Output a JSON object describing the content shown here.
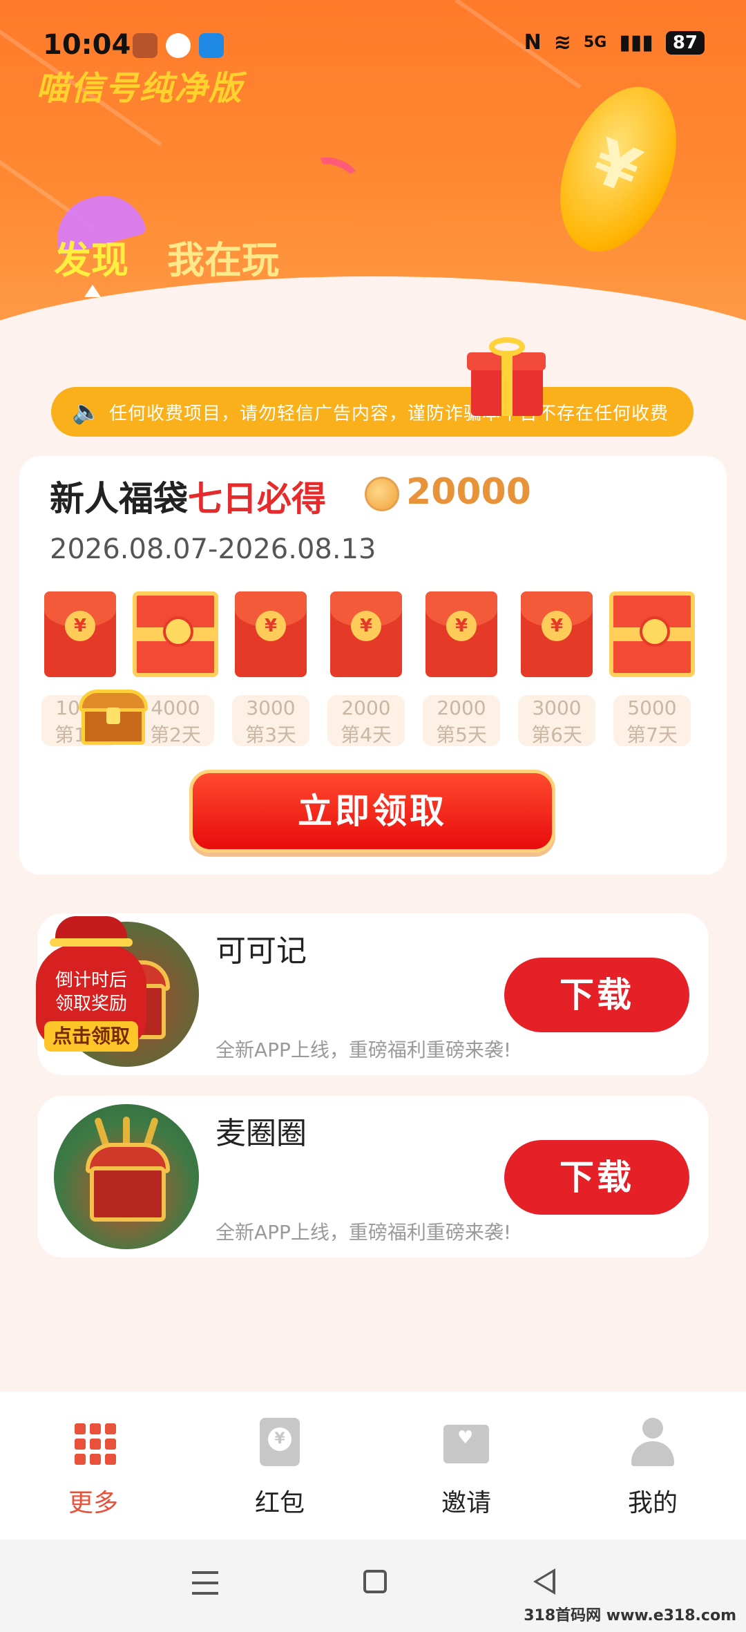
{
  "status_bar": {
    "time": "10:04",
    "network": "5G",
    "battery": "87",
    "nfc_glyph": "N",
    "wifi_glyph": "≋",
    "signal_glyph": "▮▮▮"
  },
  "header": {
    "watermark": "喵信号纯净版",
    "tabs": [
      {
        "label": "发现",
        "active": true
      },
      {
        "label": "我在玩",
        "active": false
      }
    ],
    "coin_glyph": "¥"
  },
  "notice": {
    "icon": "speaker-icon",
    "text": "任何收费项目，请勿轻信广告内容，谨防诈骗本平台不存在任何收费"
  },
  "bonus": {
    "title_prefix": "新人福袋",
    "title_highlight": "七日必得",
    "amount": "20000",
    "dates": "2026.08.07-2026.08.13",
    "days": [
      {
        "amount": "1000",
        "label": "第1天",
        "style": "small"
      },
      {
        "amount": "4000",
        "label": "第2天",
        "style": "big"
      },
      {
        "amount": "3000",
        "label": "第3天",
        "style": "small"
      },
      {
        "amount": "2000",
        "label": "第4天",
        "style": "small"
      },
      {
        "amount": "2000",
        "label": "第5天",
        "style": "small"
      },
      {
        "amount": "3000",
        "label": "第6天",
        "style": "small"
      },
      {
        "amount": "5000",
        "label": "第7天",
        "style": "big"
      }
    ],
    "envelope_glyph": "¥",
    "claim_label": "立即领取"
  },
  "countdown_badge": {
    "line1": "倒计时后",
    "line2": "领取奖励",
    "cta": "点击领取"
  },
  "apps": [
    {
      "name": "可可记",
      "desc": "全新APP上线，重磅福利重磅来袭!",
      "button": "下载"
    },
    {
      "name": "麦圈圈",
      "desc": "全新APP上线，重磅福利重磅来袭!",
      "button": "下载"
    }
  ],
  "bottom_nav": [
    {
      "label": "更多",
      "icon": "grid-icon",
      "active": true
    },
    {
      "label": "红包",
      "icon": "red-envelope-icon",
      "active": false
    },
    {
      "label": "邀请",
      "icon": "invite-icon",
      "active": false
    },
    {
      "label": "我的",
      "icon": "profile-icon",
      "active": false
    }
  ],
  "site_watermark": "318首码网 www.e318.com",
  "colors": {
    "header_orange": "#ff7a2a",
    "accent_red": "#e52027",
    "notice_yellow": "#f9b01a",
    "coin_gold": "#e8923a"
  }
}
